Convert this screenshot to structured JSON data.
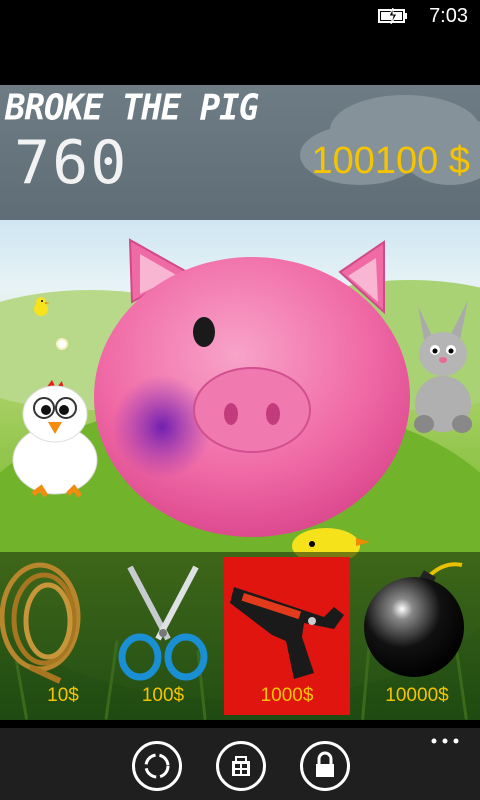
{
  "status": {
    "time": "7:03"
  },
  "header": {
    "title": "BROKE THE PIG",
    "score": "760",
    "money": "100100 $"
  },
  "tools": [
    {
      "name": "rope",
      "price": "10$",
      "selected": false
    },
    {
      "name": "scissors",
      "price": "100$",
      "selected": false
    },
    {
      "name": "gun",
      "price": "1000$",
      "selected": true
    },
    {
      "name": "bomb",
      "price": "10000$",
      "selected": false
    }
  ],
  "appbar": {
    "buttons": [
      "refresh-icon",
      "store-icon",
      "lock-icon"
    ],
    "more": "more-icon"
  },
  "colors": {
    "accent": "#f4c400",
    "selected": "#e0150f",
    "pig": "#f06aa6"
  }
}
